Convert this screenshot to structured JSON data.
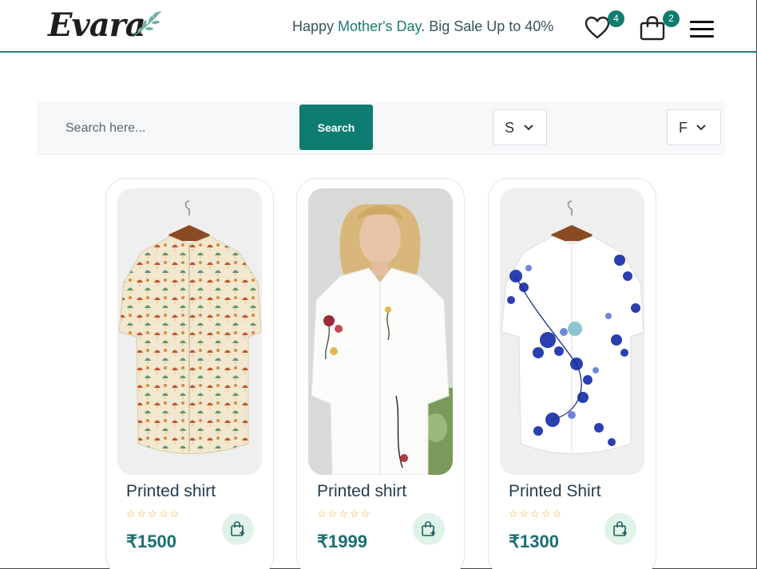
{
  "header": {
    "logo_text": "Evara",
    "promo_prefix": "Happy ",
    "promo_accent": "Mother's Day",
    "promo_suffix": ". Big Sale Up to 40%",
    "wishlist_count": "4",
    "cart_count": "2",
    "icons": [
      "heart-icon",
      "shopping-bag-icon",
      "hamburger-menu-icon"
    ]
  },
  "search": {
    "placeholder": "Search here...",
    "button_label": "Search",
    "select_1_value": "S",
    "select_2_value": "F"
  },
  "products": [
    {
      "title": "Printed shirt",
      "stars": "☆☆☆☆☆",
      "price": "₹1500",
      "rating": 0
    },
    {
      "title": "Printed shirt",
      "stars": "☆☆☆☆☆",
      "price": "₹1999",
      "rating": 0
    },
    {
      "title": "Printed Shirt",
      "stars": "☆☆☆☆☆",
      "price": "₹1300",
      "rating": 0
    }
  ],
  "colors": {
    "accent": "#0e7c6f",
    "star": "#f0a530",
    "price": "#1a6e73"
  }
}
